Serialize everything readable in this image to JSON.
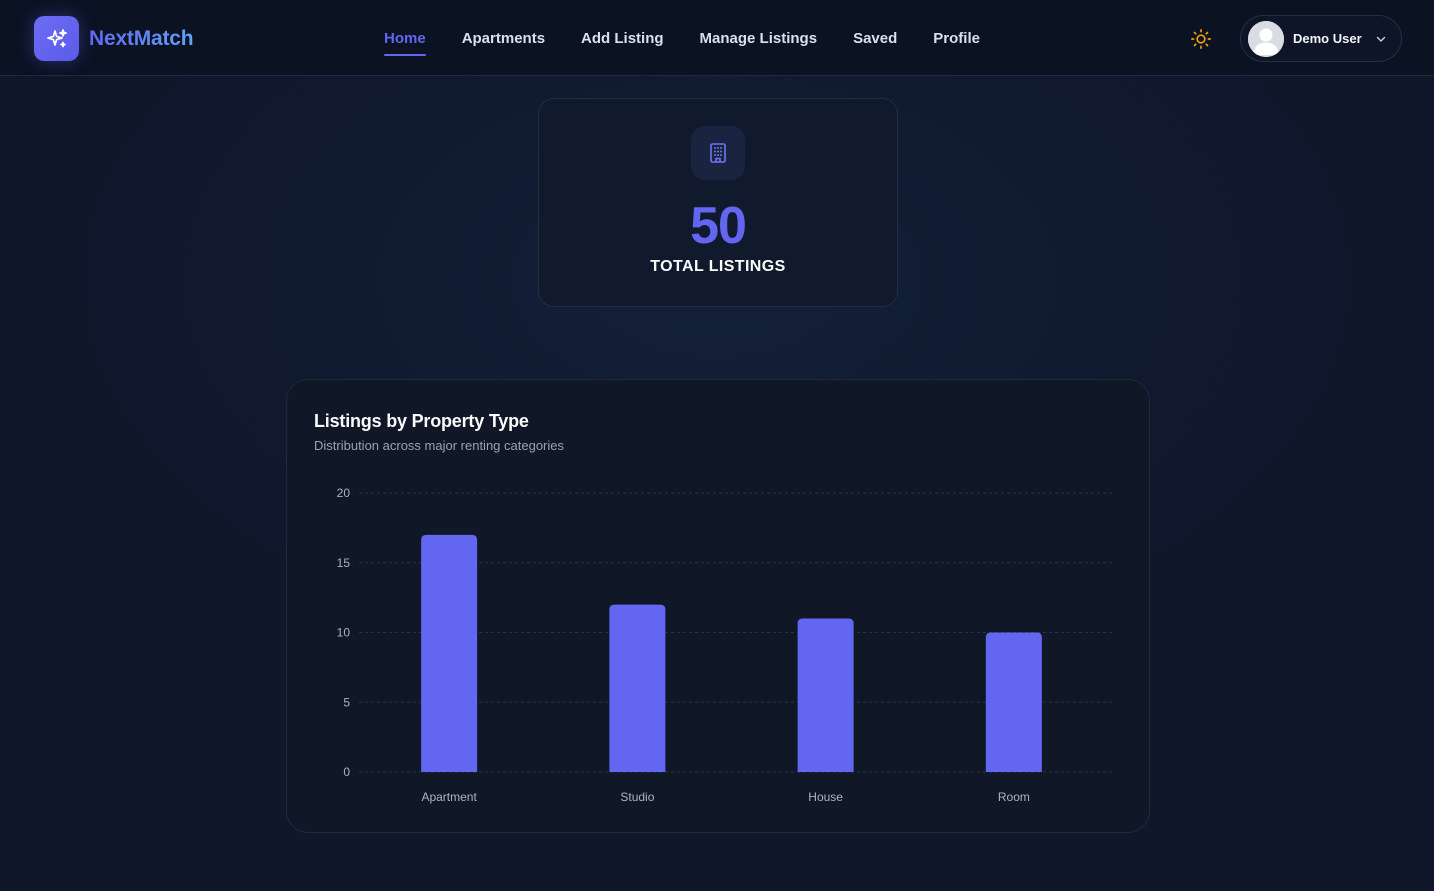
{
  "app": {
    "name": "NextMatch"
  },
  "nav": {
    "items": [
      {
        "label": "Home",
        "active": true
      },
      {
        "label": "Apartments",
        "active": false
      },
      {
        "label": "Add Listing",
        "active": false
      },
      {
        "label": "Manage Listings",
        "active": false
      },
      {
        "label": "Saved",
        "active": false
      },
      {
        "label": "Profile",
        "active": false
      }
    ]
  },
  "user": {
    "name": "Demo User"
  },
  "icons": {
    "logo": "sparkles-icon",
    "theme": "sun-icon",
    "avatar": "user-avatar-icon",
    "menu": "chevron-down-icon",
    "stat": "building-icon"
  },
  "colors": {
    "accent": "#6366f1",
    "background": "#0f172a",
    "card": "#111a2c",
    "sun": "#f59e0b"
  },
  "stats": {
    "total_value": "50",
    "total_label": "TOTAL LISTINGS"
  },
  "chart": {
    "title": "Listings by Property Type",
    "subtitle": "Distribution across major renting categories"
  },
  "chart_data": {
    "type": "bar",
    "title": "Listings by Property Type",
    "subtitle": "Distribution across major renting categories",
    "categories": [
      "Apartment",
      "Studio",
      "House",
      "Room"
    ],
    "values": [
      17,
      12,
      11,
      10
    ],
    "xlabel": "",
    "ylabel": "",
    "ylim": [
      0,
      20
    ],
    "yticks": [
      0,
      5,
      10,
      15,
      20
    ],
    "grid": true,
    "legend": "none",
    "color": "#6366f1"
  }
}
